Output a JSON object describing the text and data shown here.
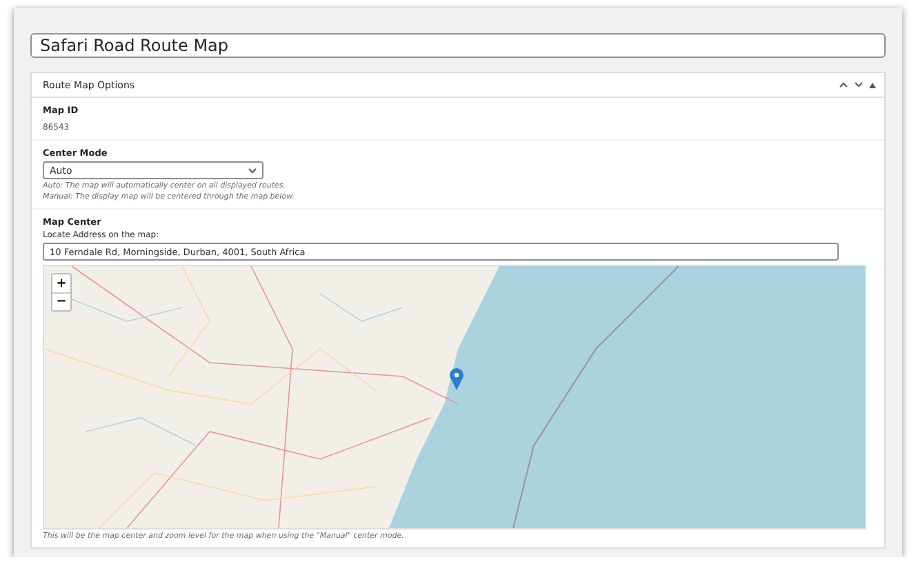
{
  "title_field": {
    "value": "Safari Road Route Map"
  },
  "panel": {
    "title": "Route Map Options",
    "expanded": true,
    "map_id": {
      "label": "Map ID",
      "value": "86543"
    },
    "center_mode": {
      "label": "Center Mode",
      "value": "Auto",
      "help": [
        "*Auto:* The map will automatically center on all displayed routes.",
        "*Manual:* The display map will be centered through the map below."
      ]
    },
    "map_center": {
      "label": "Map Center",
      "address_label": "Locate Address on the map:",
      "address": "10 Ferndale Rd, Morningside, Durban, 4001, South Africa",
      "zoom_in": "+",
      "zoom_out": "−",
      "caption": "This will be the map center and zoom level for the map when using the \"Manual\" center mode."
    }
  }
}
